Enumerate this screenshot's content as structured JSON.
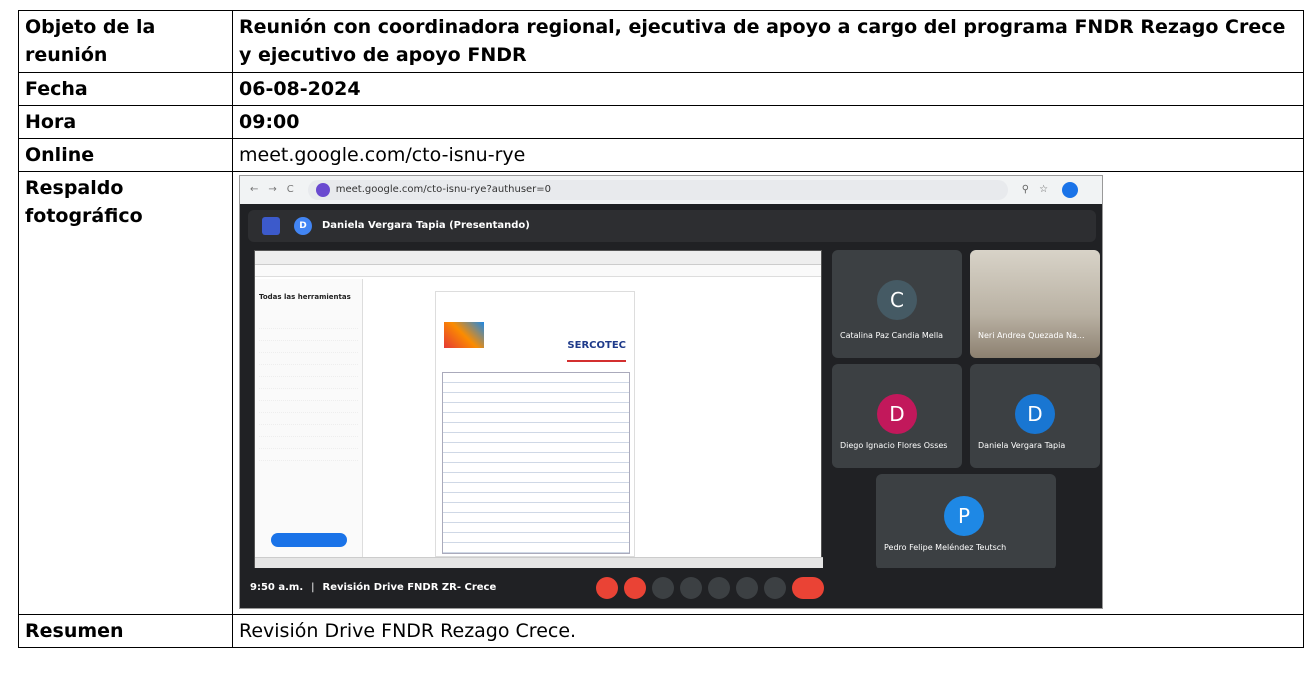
{
  "rows": {
    "objeto": {
      "label": "Objeto de la reunión",
      "value": "Reunión con coordinadora regional, ejecutiva de apoyo a cargo del programa FNDR Rezago Crece y ejecutivo de apoyo FNDR"
    },
    "fecha": {
      "label": "Fecha",
      "value": "06-08-2024"
    },
    "hora": {
      "label": "Hora",
      "value": "09:00"
    },
    "online": {
      "label": "Online",
      "value": "meet.google.com/cto-isnu-rye"
    },
    "respaldo": {
      "label": "Respaldo fotográfico"
    },
    "resumen": {
      "label": "Resumen",
      "value": "Revisión Drive FNDR Rezago Crece."
    }
  },
  "photo": {
    "url": "meet.google.com/cto-isnu-rye?authuser=0",
    "presenter": "Daniela Vergara Tapia (Presentando)",
    "sidebar_title": "Todas las herramientas",
    "doc_brand": "SERCOTEC",
    "participants": [
      {
        "initial": "C",
        "name": "Catalina Paz Candia Mella",
        "color": "#455a64"
      },
      {
        "name": "Neri Andrea Quezada Na..."
      },
      {
        "initial": "D",
        "name": "Diego Ignacio Flores Osses",
        "color": "#c2185b"
      },
      {
        "initial": "D",
        "name": "Daniela Vergara Tapia",
        "color": "#1976d2"
      },
      {
        "initial": "P",
        "name": "Pedro Felipe Meléndez Teutsch",
        "color": "#1e88e5"
      }
    ],
    "time": "9:50 a.m.",
    "meeting_title": "Revisión Drive FNDR ZR- Crece"
  }
}
